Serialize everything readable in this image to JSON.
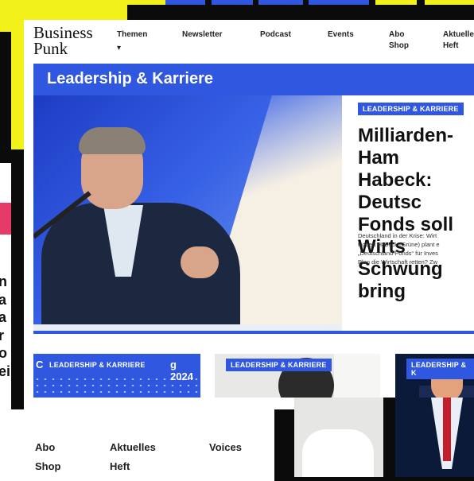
{
  "brand": {
    "logo_line1": "Business",
    "logo_line2": "Punk",
    "accent_color": "#2f57e0",
    "highlight_color": "#f2f21a"
  },
  "nav": {
    "items": [
      {
        "label": "Themen"
      },
      {
        "label": "Newsletter"
      },
      {
        "label": "Podcast"
      },
      {
        "label": "Events"
      },
      {
        "label": "Abo\nShop"
      },
      {
        "label": "Aktuelles\nHeft"
      }
    ],
    "caret": "▾"
  },
  "section": {
    "title": "Leadership & Karriere"
  },
  "hero": {
    "tag": "LEADERSHIP & KARRIERE",
    "headline": "Milliarden-Ham\nHabeck: Deutsc\nFonds soll Wirts\nSchwung bring",
    "teaser": "Deutschland in der Krise: Wirt\nRobert Habeck (Grüne) plant e\n„Deutschland-Fonds“ für Inves\nPlan die Wirtschaft retten? Zw"
  },
  "cards": [
    {
      "tag": "LEADERSHIP & KARRIERE",
      "year_text": "g 2024",
      "fragment": "C"
    },
    {
      "tag": "LEADERSHIP & KARRIERE"
    },
    {
      "tag": "LEADERSHIP & K"
    }
  ],
  "left_fragment": {
    "letters": [
      "n",
      "a",
      "a",
      "r",
      "o",
      "ei"
    ]
  },
  "bottom_nav": {
    "items": [
      "Abo",
      "Aktuelles",
      "Voices",
      "Shop",
      "Heft"
    ]
  }
}
